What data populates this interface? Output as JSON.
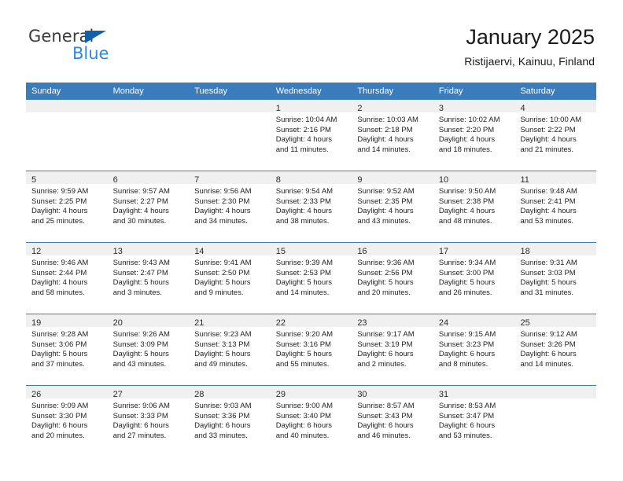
{
  "brand": {
    "name_part1": "General",
    "name_part2": "Blue",
    "triangle_color": "#1261ab",
    "blue_color": "#2e8bd8"
  },
  "header": {
    "title": "January 2025",
    "subtitle": "Ristijaervi, Kainuu, Finland"
  },
  "theme": {
    "header_blue": "#3b7cbd",
    "daynum_band": "#f0f0f0",
    "text": "#1f1f1f"
  },
  "weekdays": [
    "Sunday",
    "Monday",
    "Tuesday",
    "Wednesday",
    "Thursday",
    "Friday",
    "Saturday"
  ],
  "weeks": [
    [
      {
        "day": "",
        "lines": []
      },
      {
        "day": "",
        "lines": []
      },
      {
        "day": "",
        "lines": []
      },
      {
        "day": "1",
        "lines": [
          "Sunrise: 10:04 AM",
          "Sunset: 2:16 PM",
          "Daylight: 4 hours",
          "and 11 minutes."
        ]
      },
      {
        "day": "2",
        "lines": [
          "Sunrise: 10:03 AM",
          "Sunset: 2:18 PM",
          "Daylight: 4 hours",
          "and 14 minutes."
        ]
      },
      {
        "day": "3",
        "lines": [
          "Sunrise: 10:02 AM",
          "Sunset: 2:20 PM",
          "Daylight: 4 hours",
          "and 18 minutes."
        ]
      },
      {
        "day": "4",
        "lines": [
          "Sunrise: 10:00 AM",
          "Sunset: 2:22 PM",
          "Daylight: 4 hours",
          "and 21 minutes."
        ]
      }
    ],
    [
      {
        "day": "5",
        "lines": [
          "Sunrise: 9:59 AM",
          "Sunset: 2:25 PM",
          "Daylight: 4 hours",
          "and 25 minutes."
        ]
      },
      {
        "day": "6",
        "lines": [
          "Sunrise: 9:57 AM",
          "Sunset: 2:27 PM",
          "Daylight: 4 hours",
          "and 30 minutes."
        ]
      },
      {
        "day": "7",
        "lines": [
          "Sunrise: 9:56 AM",
          "Sunset: 2:30 PM",
          "Daylight: 4 hours",
          "and 34 minutes."
        ]
      },
      {
        "day": "8",
        "lines": [
          "Sunrise: 9:54 AM",
          "Sunset: 2:33 PM",
          "Daylight: 4 hours",
          "and 38 minutes."
        ]
      },
      {
        "day": "9",
        "lines": [
          "Sunrise: 9:52 AM",
          "Sunset: 2:35 PM",
          "Daylight: 4 hours",
          "and 43 minutes."
        ]
      },
      {
        "day": "10",
        "lines": [
          "Sunrise: 9:50 AM",
          "Sunset: 2:38 PM",
          "Daylight: 4 hours",
          "and 48 minutes."
        ]
      },
      {
        "day": "11",
        "lines": [
          "Sunrise: 9:48 AM",
          "Sunset: 2:41 PM",
          "Daylight: 4 hours",
          "and 53 minutes."
        ]
      }
    ],
    [
      {
        "day": "12",
        "lines": [
          "Sunrise: 9:46 AM",
          "Sunset: 2:44 PM",
          "Daylight: 4 hours",
          "and 58 minutes."
        ]
      },
      {
        "day": "13",
        "lines": [
          "Sunrise: 9:43 AM",
          "Sunset: 2:47 PM",
          "Daylight: 5 hours",
          "and 3 minutes."
        ]
      },
      {
        "day": "14",
        "lines": [
          "Sunrise: 9:41 AM",
          "Sunset: 2:50 PM",
          "Daylight: 5 hours",
          "and 9 minutes."
        ]
      },
      {
        "day": "15",
        "lines": [
          "Sunrise: 9:39 AM",
          "Sunset: 2:53 PM",
          "Daylight: 5 hours",
          "and 14 minutes."
        ]
      },
      {
        "day": "16",
        "lines": [
          "Sunrise: 9:36 AM",
          "Sunset: 2:56 PM",
          "Daylight: 5 hours",
          "and 20 minutes."
        ]
      },
      {
        "day": "17",
        "lines": [
          "Sunrise: 9:34 AM",
          "Sunset: 3:00 PM",
          "Daylight: 5 hours",
          "and 26 minutes."
        ]
      },
      {
        "day": "18",
        "lines": [
          "Sunrise: 9:31 AM",
          "Sunset: 3:03 PM",
          "Daylight: 5 hours",
          "and 31 minutes."
        ]
      }
    ],
    [
      {
        "day": "19",
        "lines": [
          "Sunrise: 9:28 AM",
          "Sunset: 3:06 PM",
          "Daylight: 5 hours",
          "and 37 minutes."
        ]
      },
      {
        "day": "20",
        "lines": [
          "Sunrise: 9:26 AM",
          "Sunset: 3:09 PM",
          "Daylight: 5 hours",
          "and 43 minutes."
        ]
      },
      {
        "day": "21",
        "lines": [
          "Sunrise: 9:23 AM",
          "Sunset: 3:13 PM",
          "Daylight: 5 hours",
          "and 49 minutes."
        ]
      },
      {
        "day": "22",
        "lines": [
          "Sunrise: 9:20 AM",
          "Sunset: 3:16 PM",
          "Daylight: 5 hours",
          "and 55 minutes."
        ]
      },
      {
        "day": "23",
        "lines": [
          "Sunrise: 9:17 AM",
          "Sunset: 3:19 PM",
          "Daylight: 6 hours",
          "and 2 minutes."
        ]
      },
      {
        "day": "24",
        "lines": [
          "Sunrise: 9:15 AM",
          "Sunset: 3:23 PM",
          "Daylight: 6 hours",
          "and 8 minutes."
        ]
      },
      {
        "day": "25",
        "lines": [
          "Sunrise: 9:12 AM",
          "Sunset: 3:26 PM",
          "Daylight: 6 hours",
          "and 14 minutes."
        ]
      }
    ],
    [
      {
        "day": "26",
        "lines": [
          "Sunrise: 9:09 AM",
          "Sunset: 3:30 PM",
          "Daylight: 6 hours",
          "and 20 minutes."
        ]
      },
      {
        "day": "27",
        "lines": [
          "Sunrise: 9:06 AM",
          "Sunset: 3:33 PM",
          "Daylight: 6 hours",
          "and 27 minutes."
        ]
      },
      {
        "day": "28",
        "lines": [
          "Sunrise: 9:03 AM",
          "Sunset: 3:36 PM",
          "Daylight: 6 hours",
          "and 33 minutes."
        ]
      },
      {
        "day": "29",
        "lines": [
          "Sunrise: 9:00 AM",
          "Sunset: 3:40 PM",
          "Daylight: 6 hours",
          "and 40 minutes."
        ]
      },
      {
        "day": "30",
        "lines": [
          "Sunrise: 8:57 AM",
          "Sunset: 3:43 PM",
          "Daylight: 6 hours",
          "and 46 minutes."
        ]
      },
      {
        "day": "31",
        "lines": [
          "Sunrise: 8:53 AM",
          "Sunset: 3:47 PM",
          "Daylight: 6 hours",
          "and 53 minutes."
        ]
      },
      {
        "day": "",
        "lines": []
      }
    ]
  ]
}
